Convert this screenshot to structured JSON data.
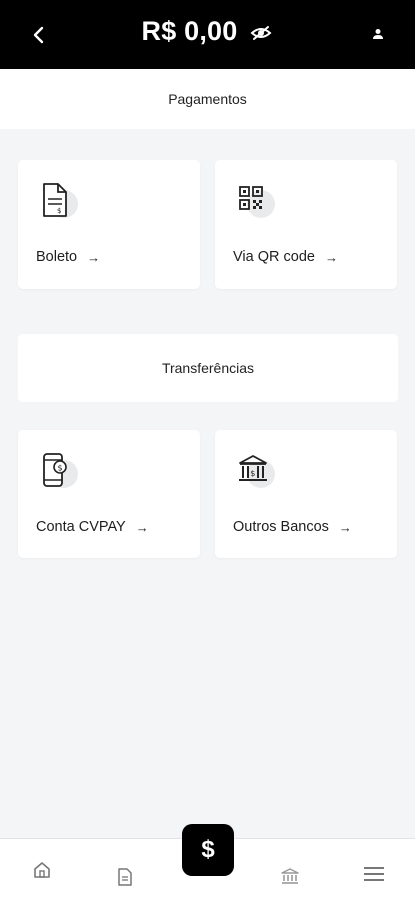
{
  "header": {
    "balance": "R$ 0,00",
    "back_icon": "chevron-left-icon",
    "visibility_icon": "eye-slash-icon",
    "profile_icon": "user-icon"
  },
  "sections": {
    "payments_title": "Pagamentos",
    "transfers_title": "Transferências"
  },
  "payments": [
    {
      "label": "Boleto",
      "arrow": "→",
      "icon": "document-icon"
    },
    {
      "label": "Via QR code",
      "arrow": "→",
      "icon": "qr-code-icon"
    }
  ],
  "transfers": [
    {
      "label": "Conta CVPAY",
      "arrow": "→",
      "icon": "phone-money-icon"
    },
    {
      "label": "Outros Bancos",
      "arrow": "→",
      "icon": "bank-icon"
    }
  ],
  "bottom_nav": {
    "items": [
      "home-icon",
      "document-icon",
      "dollar-icon",
      "bank-icon",
      "menu-icon"
    ],
    "fab_symbol": "$"
  },
  "colors": {
    "header_bg": "#000000",
    "page_bg": "#f4f5f7",
    "card_bg": "#ffffff"
  }
}
